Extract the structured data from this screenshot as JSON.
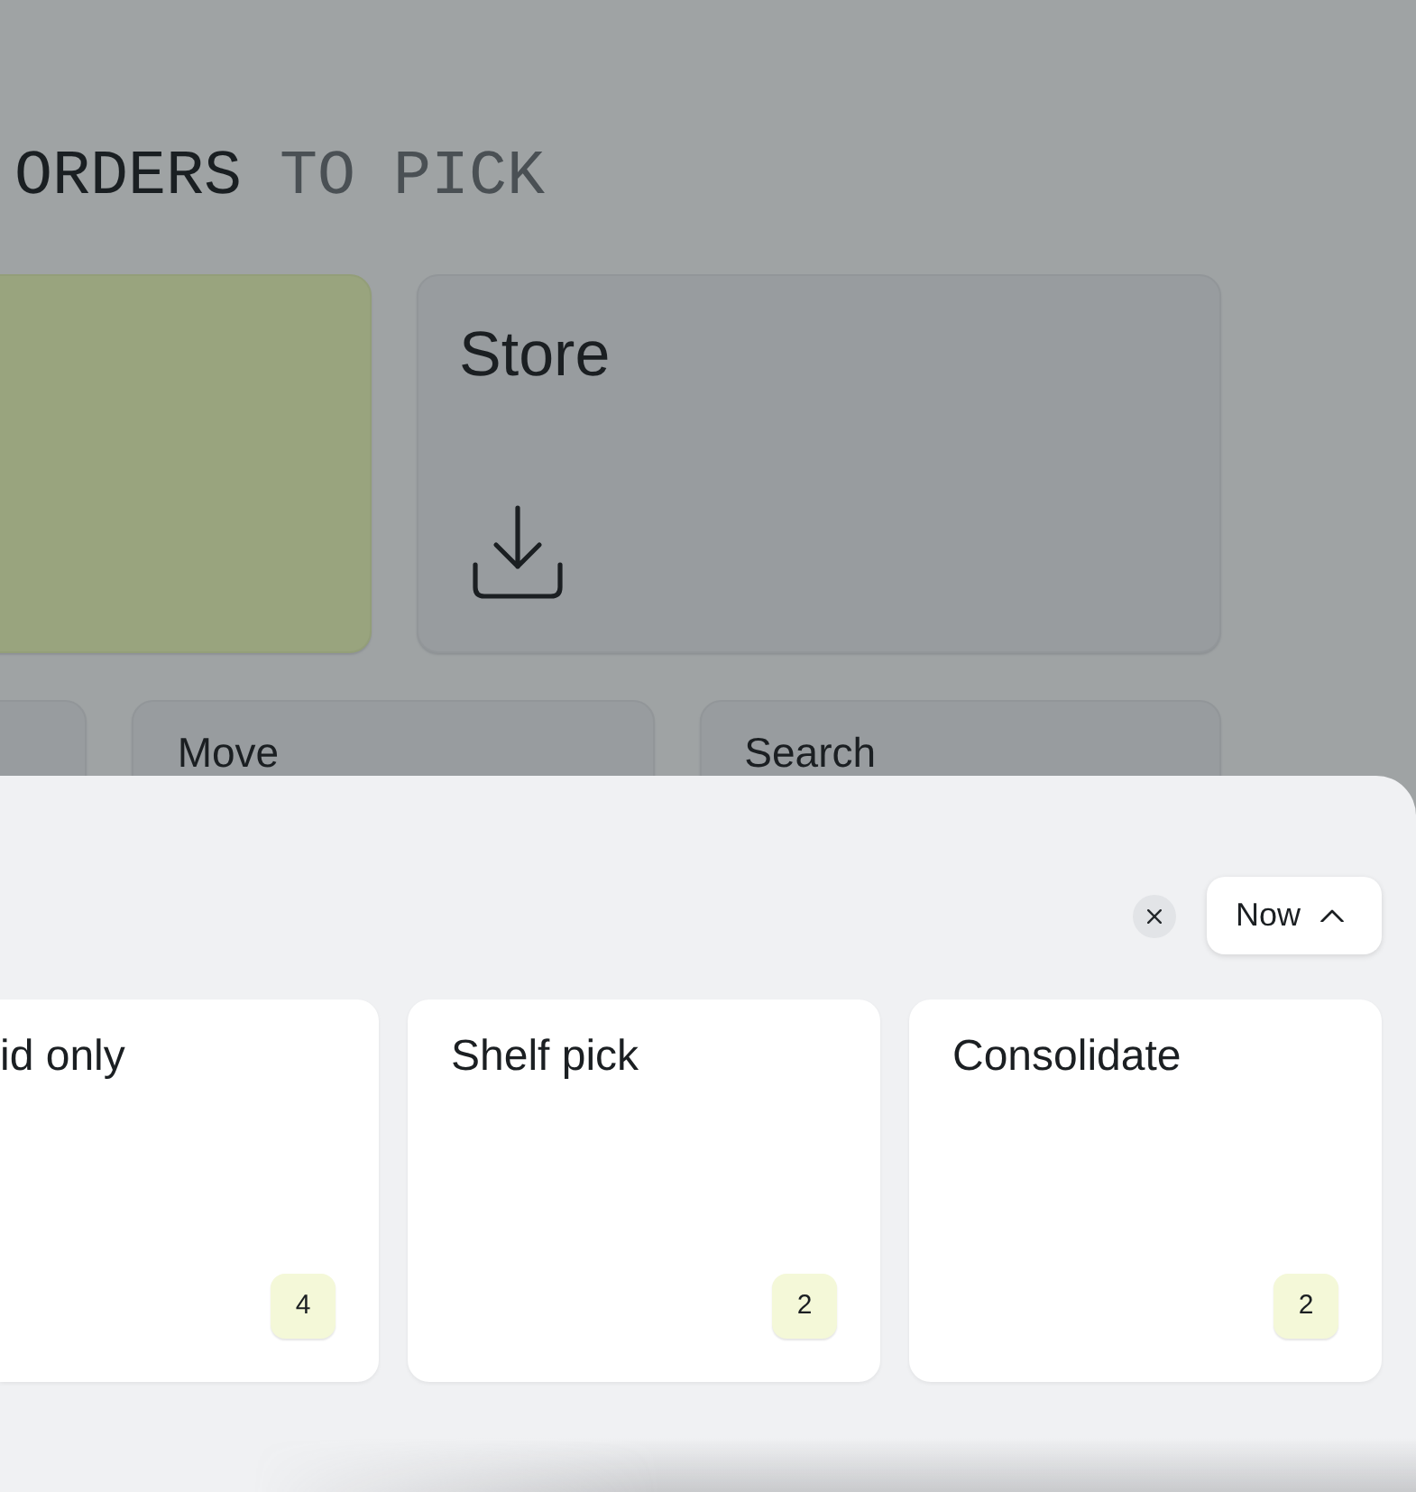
{
  "heading": [
    {
      "text": "ORDERS",
      "emphasis": true
    },
    {
      "text": "TO PICK",
      "emphasis": false
    }
  ],
  "tile_rows": [
    [
      {
        "kind": "accent"
      },
      {
        "kind": "icon",
        "label": "Store"
      }
    ],
    [
      {
        "kind": "plain"
      },
      {
        "kind": "plain",
        "label": "Move"
      },
      {
        "kind": "plain",
        "label": "Search"
      }
    ]
  ],
  "sheet": {
    "time_button": {
      "label": "Now"
    },
    "cards": [
      {
        "label": "id only",
        "count": "4"
      },
      {
        "label": "Shelf pick",
        "count": "2"
      },
      {
        "label": "Consolidate",
        "count": "2"
      }
    ]
  }
}
